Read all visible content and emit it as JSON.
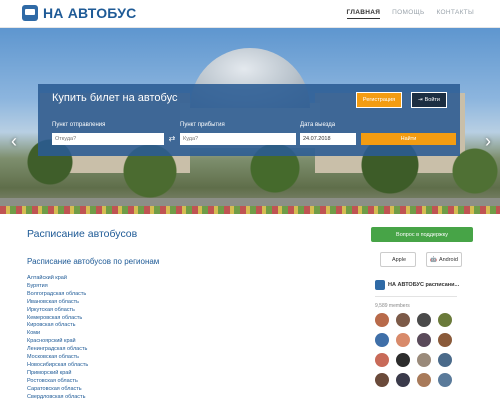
{
  "header": {
    "logo_text": "НА АВТОБУС",
    "nav": [
      {
        "label": "ГЛАВНАЯ",
        "active": true
      },
      {
        "label": "ПОМОЩЬ",
        "active": false
      },
      {
        "label": "КОНТАКТЫ",
        "active": false
      }
    ]
  },
  "hero": {
    "prev_arrow": "‹",
    "next_arrow": "›",
    "panel": {
      "title": "Купить билет на автобус",
      "register_label": "Регистрация",
      "login_label": "Войти",
      "from_label": "Пункт отправления",
      "from_placeholder": "Откуда?",
      "to_label": "Пункт прибытия",
      "to_placeholder": "Куда?",
      "date_label": "Дата выезда",
      "date_value": "24.07.2018",
      "find_label": "Найти",
      "swap_icon": "⇄"
    }
  },
  "main": {
    "schedule_title": "Расписание автобусов",
    "regions_title": "Расписание автобусов по регионам",
    "regions": [
      "Алтайский край",
      "Бурятия",
      "Волгоградская область",
      "Ивановская область",
      "Иркутская область",
      "Кемеровская область",
      "Кировская область",
      "Коми",
      "Красноярский край",
      "Ленинградская область",
      "Московская область",
      "Новосибирская область",
      "Приморский край",
      "Ростовская область",
      "Саратовская область",
      "Свердловская область"
    ]
  },
  "sidebar": {
    "support_label": "Вопрос в поддержку",
    "apple_label": "Apple",
    "android_label": "Android",
    "vk_name": "НА АВТОБУС расписани...",
    "vk_members": "9,589 members",
    "member_colors": [
      "#b86a4a",
      "#7c5a48",
      "#4a4a4a",
      "#6a7a3a",
      "#3f6fa8",
      "#d88a6a",
      "#5a4a5a",
      "#8a5a3a",
      "#c86a58",
      "#2c2c2c",
      "#9a8a7a",
      "#4a6a8a",
      "#6a4a3a",
      "#3a3a4a",
      "#a87a5a",
      "#5a7a9a"
    ]
  },
  "colors": {
    "brand": "#1e5a96",
    "accent": "#f39c12",
    "success": "#47a447"
  }
}
